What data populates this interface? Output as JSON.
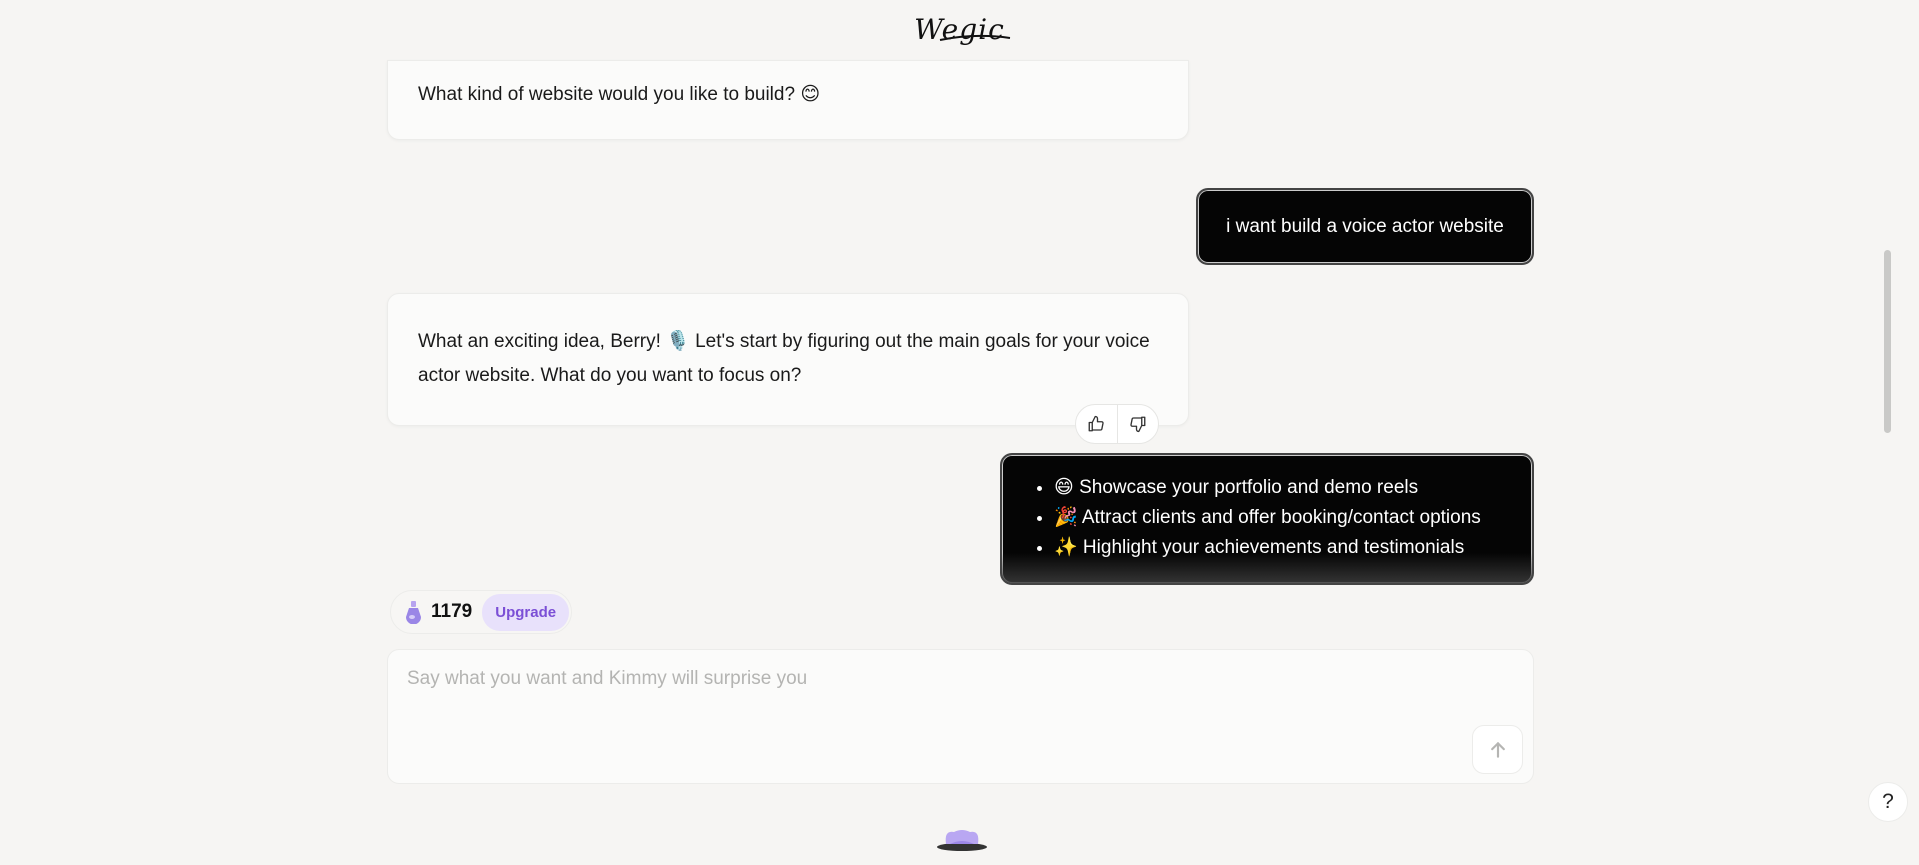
{
  "header": {
    "logo_text": "Wegic"
  },
  "messages": {
    "ai_1": {
      "text": "What kind of website would you like to build? 😊"
    },
    "user_1": {
      "text": "i want build a voice actor website"
    },
    "ai_2": {
      "text": "What an exciting idea, Berry! 🎙️ Let's start by figuring out the main goals for your voice actor website. What do you want to focus on?"
    },
    "user_2": {
      "items": [
        "😄 Showcase your portfolio and demo reels",
        "🎉 Attract clients and offer booking/contact options",
        "✨ Highlight your achievements and testimonials"
      ]
    }
  },
  "feedback": {
    "like_icon": "thumbs-up-icon",
    "dislike_icon": "thumbs-down-icon"
  },
  "credits": {
    "count": "1179",
    "upgrade_label": "Upgrade",
    "icon": "potion-icon"
  },
  "composer": {
    "placeholder": "Say what you want and Kimmy will surprise you",
    "value": "",
    "send_icon": "arrow-up-icon"
  },
  "help": {
    "label": "?"
  },
  "colors": {
    "background": "#f6f5f3",
    "user_bubble": "#050505",
    "upgrade_bg": "#e8e1fb",
    "upgrade_text": "#7b4fd6"
  }
}
